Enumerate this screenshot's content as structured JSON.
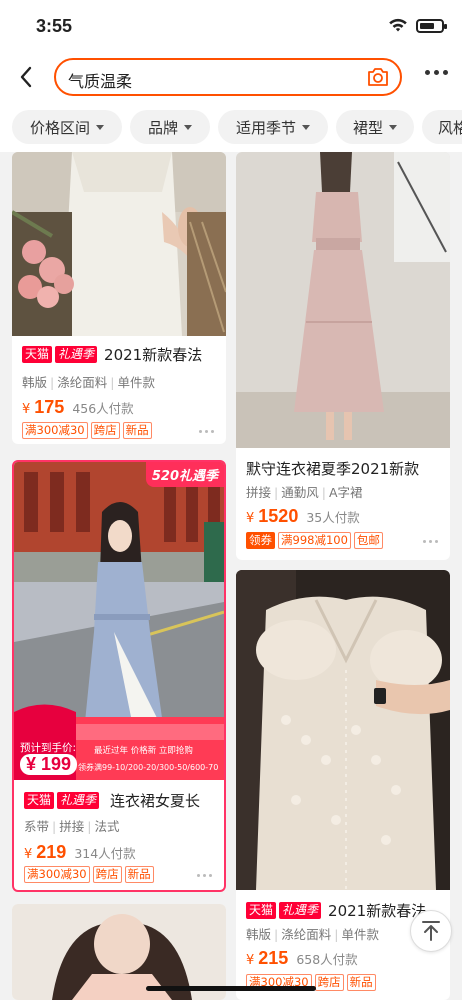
{
  "status_bar": {
    "time": "3:55",
    "battery_level": 0.72
  },
  "search": {
    "query": "气质温柔"
  },
  "filters": [
    {
      "label": "价格区间"
    },
    {
      "label": "品牌"
    },
    {
      "label": "适用季节"
    },
    {
      "label": "裙型"
    },
    {
      "label": "风格"
    }
  ],
  "products": [
    {
      "tag1": "天猫",
      "tag2": "礼遇季",
      "title": "2021新款春法",
      "attrs": [
        "韩版",
        "涤纶面料",
        "单件款"
      ],
      "currency": "¥",
      "price": "175",
      "sold": "456人付款",
      "promos": [
        "满300减30",
        "跨店",
        "新品"
      ]
    },
    {
      "title": "默守连衣裙夏季2021新款",
      "attrs": [
        "拼接",
        "通勤风",
        "A字裙"
      ],
      "currency": "¥",
      "price": "1520",
      "sold": "35人付款",
      "promos": [
        "领券",
        "满998减100",
        "包邮"
      ]
    },
    {
      "badge": "520礼遇季",
      "promo_banner_price_label": "预计到手价:",
      "promo_banner_price": "¥ 199",
      "promo_banner_line1": "最近过年 价格新 立即抢购",
      "promo_banner_line2": "领券满99-10/200-20/300-50/600-70",
      "tag1": "天猫",
      "tag2": "礼遇季",
      "title": "连衣裙女夏长",
      "attrs": [
        "系带",
        "拼接",
        "法式"
      ],
      "currency": "¥",
      "price": "219",
      "sold": "314人付款",
      "promos": [
        "满300减30",
        "跨店",
        "新品"
      ]
    },
    {
      "tag1": "天猫",
      "tag2": "礼遇季",
      "title": "2021新款春法",
      "attrs": [
        "韩版",
        "涤纶面料",
        "单件款"
      ],
      "currency": "¥",
      "price": "215",
      "sold": "658人付款",
      "promos": [
        "满300减30",
        "跨店",
        "新品"
      ]
    }
  ],
  "colors": {
    "accent": "#ff5000",
    "tmall_red": "#ff0036"
  }
}
